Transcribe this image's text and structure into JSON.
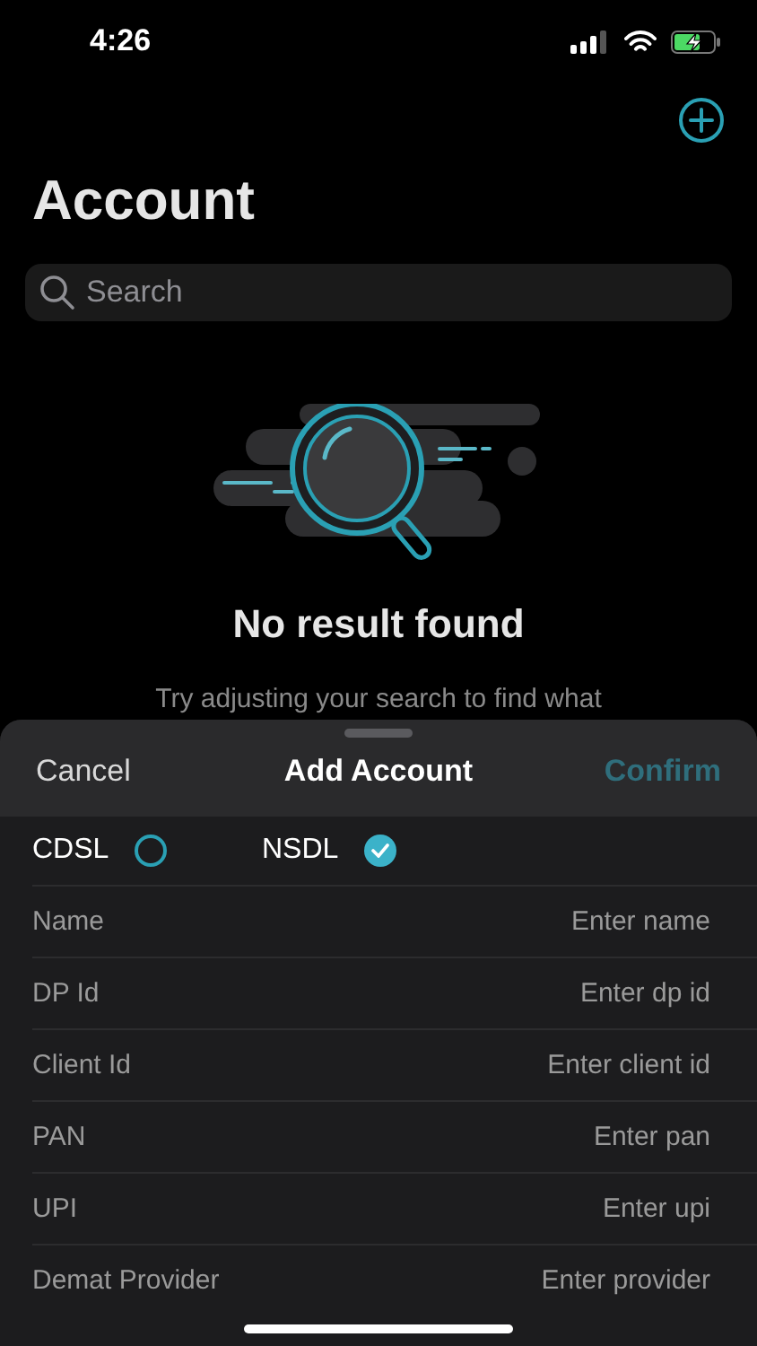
{
  "status_bar": {
    "time": "4:26"
  },
  "header": {
    "title": "Account"
  },
  "search": {
    "placeholder": "Search"
  },
  "empty_state": {
    "title": "No result found",
    "message": "Try adjusting your search to find what"
  },
  "sheet": {
    "cancel": "Cancel",
    "title": "Add Account",
    "confirm": {
      "label": "Confirm",
      "disabled": true
    },
    "depositories": [
      {
        "label": "CDSL",
        "selected": false
      },
      {
        "label": "NSDL",
        "selected": true
      }
    ],
    "fields": [
      {
        "label": "Name",
        "placeholder": "Enter name"
      },
      {
        "label": "DP Id",
        "placeholder": "Enter dp id"
      },
      {
        "label": "Client Id",
        "placeholder": "Enter client id"
      },
      {
        "label": "PAN",
        "placeholder": "Enter pan"
      },
      {
        "label": "UPI",
        "placeholder": "Enter upi"
      },
      {
        "label": "Demat Provider",
        "placeholder": "Enter provider"
      }
    ]
  }
}
